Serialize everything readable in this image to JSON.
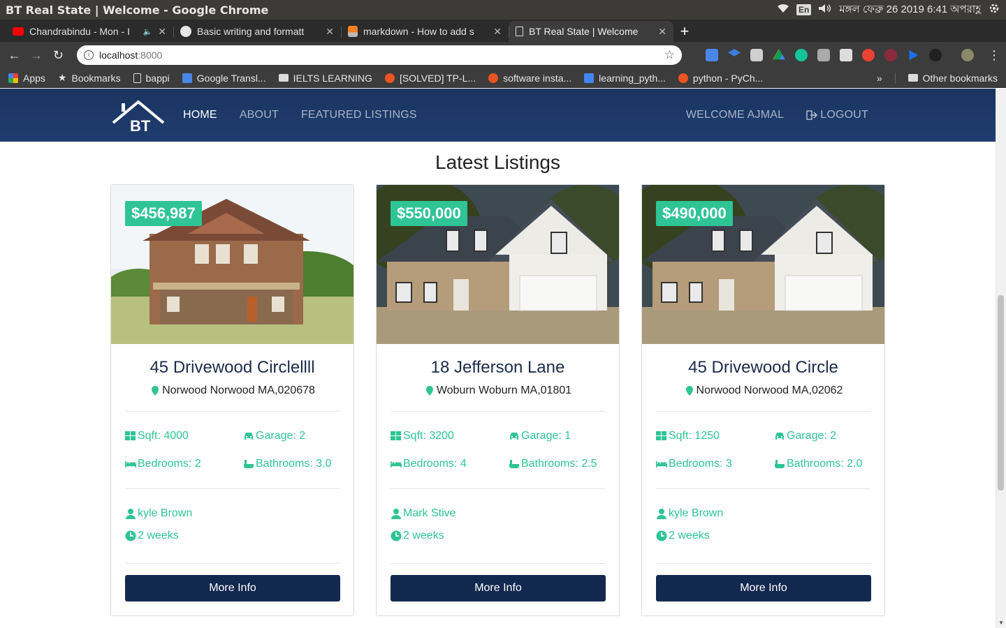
{
  "window": {
    "title": "BT Real State | Welcome - Google Chrome",
    "lang": "En",
    "clock": "মঙ্গল ফেব্রু 26 2019 6:41 অপরাহ্ণ"
  },
  "tabs": [
    {
      "label": "Chandrabindu - Mon - I",
      "favicon": "youtube",
      "active": false
    },
    {
      "label": "Basic writing and formatt",
      "favicon": "github",
      "active": false
    },
    {
      "label": "markdown - How to add s",
      "favicon": "stackoverflow",
      "active": false
    },
    {
      "label": "BT Real State | Welcome",
      "favicon": "page",
      "active": true
    }
  ],
  "address": {
    "host": "localhost",
    "port": ":8000"
  },
  "bookmarks": [
    {
      "label": "Apps",
      "icon": "apps-grid"
    },
    {
      "label": "Bookmarks",
      "icon": "star"
    },
    {
      "label": "bappi",
      "icon": "page"
    },
    {
      "label": "Google Transl...",
      "icon": "google-translate"
    },
    {
      "label": "IELTS LEARNING",
      "icon": "folder"
    },
    {
      "label": "[SOLVED] TP-L...",
      "icon": "ubuntu"
    },
    {
      "label": "software insta...",
      "icon": "askubuntu"
    },
    {
      "label": "learning_pyth...",
      "icon": "bookmark-blue"
    },
    {
      "label": "python - PyCh...",
      "icon": "askubuntu"
    }
  ],
  "bookmarks_overflow": "»",
  "other_bookmarks": "Other bookmarks",
  "site": {
    "nav": {
      "home": "HOME",
      "about": "ABOUT",
      "featured": "FEATURED LISTINGS",
      "welcome": "WELCOME AJMAL",
      "logout": "LOGOUT"
    },
    "logo_text": "BT",
    "section_title": "Latest Listings"
  },
  "listings": [
    {
      "price": "$456,987",
      "title": "45 Drivewood Circlellll",
      "address": "Norwood Norwood MA,020678",
      "sqft": "Sqft: 4000",
      "garage": "Garage: 2",
      "bedrooms": "Bedrooms: 2",
      "bathrooms": "Bathrooms: 3.0",
      "realtor": "kyle Brown",
      "listed": "2 weeks",
      "button": "More Info",
      "image": "craftsman-house"
    },
    {
      "price": "$550,000",
      "title": "18 Jefferson Lane",
      "address": "Woburn Woburn MA,01801",
      "sqft": "Sqft: 3200",
      "garage": "Garage: 1",
      "bedrooms": "Bedrooms: 4",
      "bathrooms": "Bathrooms: 2.5",
      "realtor": "Mark Stive",
      "listed": "2 weeks",
      "button": "More Info",
      "image": "suburban-house"
    },
    {
      "price": "$490,000",
      "title": "45 Drivewood Circle",
      "address": "Norwood Norwood MA,02062",
      "sqft": "Sqft: 1250",
      "garage": "Garage: 2",
      "bedrooms": "Bedrooms: 3",
      "bathrooms": "Bathrooms: 2.0",
      "realtor": "kyle Brown",
      "listed": "2 weeks",
      "button": "More Info",
      "image": "suburban-house"
    }
  ],
  "colors": {
    "navbar": "#1e3a6b",
    "accent": "#2fc494",
    "button": "#13284f"
  }
}
